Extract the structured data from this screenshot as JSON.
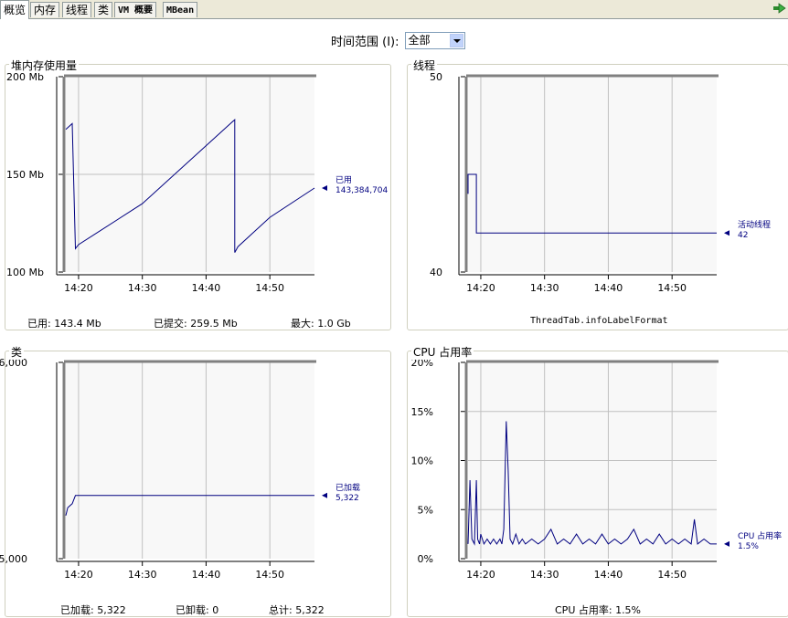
{
  "tabs": [
    {
      "label": "概览",
      "active": true
    },
    {
      "label": "内存"
    },
    {
      "label": "线程"
    },
    {
      "label": "类"
    },
    {
      "label": "VM 概要"
    },
    {
      "label": "MBean"
    }
  ],
  "time_range": {
    "label": "时间范围 (I):",
    "value": "全部"
  },
  "colors": {
    "series": "#000080",
    "grid": "#c0c0c0",
    "plot_bg": "#f8f8f8",
    "frame": "#808080"
  },
  "panels": {
    "heap": {
      "title": "堆内存使用量",
      "footer": {
        "used_label": "已用:",
        "used_value": "143.4 Mb",
        "committed_label": "已提交:",
        "committed_value": "259.5 Mb",
        "max_label": "最大:",
        "max_value": "1.0 Gb"
      }
    },
    "threads": {
      "title": "线程",
      "footer": "ThreadTab.infoLabelFormat"
    },
    "classes": {
      "title": "类",
      "footer": {
        "loaded_label": "已加载:",
        "loaded_value": "5,322",
        "unloaded_label": "已卸载:",
        "unloaded_value": "0",
        "total_label": "总计:",
        "total_value": "5,322"
      }
    },
    "cpu": {
      "title": "CPU 占用率",
      "footer": "CPU 占用率: 1.5%"
    }
  },
  "chart_data": [
    {
      "id": "heap",
      "type": "line",
      "y_ticks": [
        "200 Mb",
        "150 Mb",
        "100 Mb"
      ],
      "ylim": [
        100,
        200
      ],
      "x_ticks": [
        "14:20",
        "14:30",
        "14:40",
        "14:50"
      ],
      "xlim": [
        "14:18",
        "14:57"
      ],
      "series": [
        {
          "name": "已用",
          "value_label": "143,384,704",
          "x": [
            "14:18",
            "14:19",
            "14:19",
            "14:19.5",
            "14:20",
            "14:30",
            "14:44.5",
            "14:44.5",
            "14:45",
            "14:50",
            "14:57"
          ],
          "y": [
            173,
            176,
            176,
            112,
            114,
            135,
            178,
            110,
            113,
            128,
            143
          ]
        }
      ]
    },
    {
      "id": "threads",
      "type": "line",
      "y_ticks": [
        "50",
        "40"
      ],
      "ylim": [
        40,
        50
      ],
      "x_ticks": [
        "14:20",
        "14:30",
        "14:40",
        "14:50"
      ],
      "xlim": [
        "14:18",
        "14:57"
      ],
      "series": [
        {
          "name": "活动线程",
          "value_label": "42",
          "x": [
            "14:18",
            "14:18",
            "14:19.3",
            "14:19.3",
            "14:57"
          ],
          "y": [
            44,
            45,
            45,
            42,
            42
          ]
        }
      ]
    },
    {
      "id": "classes",
      "type": "line",
      "y_ticks": [
        "6,000",
        "5,000"
      ],
      "ylim": [
        5000,
        6000
      ],
      "x_ticks": [
        "14:20",
        "14:30",
        "14:40",
        "14:50"
      ],
      "xlim": [
        "14:18",
        "14:57"
      ],
      "series": [
        {
          "name": "已加载",
          "value_label": "5,322",
          "x": [
            "14:18",
            "14:18.3",
            "14:19",
            "14:19.5",
            "14:57"
          ],
          "y": [
            5220,
            5260,
            5280,
            5322,
            5322
          ]
        }
      ]
    },
    {
      "id": "cpu",
      "type": "line",
      "y_ticks": [
        "20%",
        "15%",
        "10%",
        "5%",
        "0%"
      ],
      "ylim": [
        0,
        20
      ],
      "x_ticks": [
        "14:20",
        "14:30",
        "14:40",
        "14:50"
      ],
      "xlim": [
        "14:18",
        "14:57"
      ],
      "series": [
        {
          "name": "CPU 占用率",
          "value_label": "1.5%",
          "x": [
            "14:18",
            "14:18.3",
            "14:18.6",
            "14:19",
            "14:19.3",
            "14:19.5",
            "14:19.8",
            "14:20",
            "14:20.5",
            "14:21",
            "14:21.5",
            "14:22",
            "14:22.5",
            "14:23",
            "14:23.3",
            "14:23.6",
            "14:24",
            "14:24.3",
            "14:24.6",
            "14:25",
            "14:25.5",
            "14:26",
            "14:26.5",
            "14:27",
            "14:28",
            "14:29",
            "14:30",
            "14:31",
            "14:32",
            "14:33",
            "14:34",
            "14:35",
            "14:36",
            "14:37",
            "14:38",
            "14:39",
            "14:40",
            "14:41",
            "14:42",
            "14:43",
            "14:44",
            "14:45",
            "14:46",
            "14:47",
            "14:48",
            "14:49",
            "14:50",
            "14:51",
            "14:52",
            "14:53",
            "14:53.5",
            "14:54",
            "14:55",
            "14:56",
            "14:57"
          ],
          "y": [
            1.5,
            8,
            2,
            1.5,
            8,
            2,
            1.5,
            2.5,
            1.5,
            2,
            1.5,
            2,
            1.5,
            2,
            1.5,
            3,
            14,
            9,
            2,
            1.5,
            2.5,
            1.5,
            2,
            1.5,
            2,
            1.5,
            2,
            3,
            1.5,
            2,
            1.5,
            2.5,
            1.5,
            2,
            1.5,
            2.5,
            1.5,
            2,
            1.5,
            2,
            3,
            1.5,
            2,
            1.5,
            2.5,
            1.5,
            2,
            1.5,
            2,
            1.5,
            4,
            1.5,
            2,
            1.5,
            1.5
          ]
        }
      ]
    }
  ]
}
